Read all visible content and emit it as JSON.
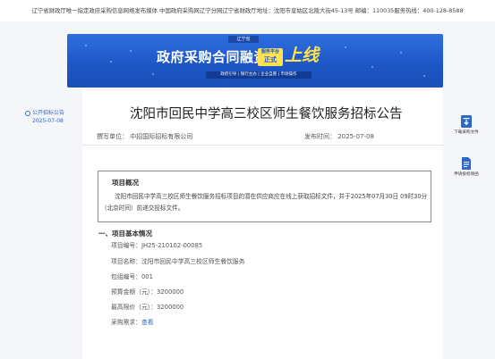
{
  "topbar": {
    "text": "辽宁省财政厅唯一指定政府采购信息网络发布媒体 中国政府采购网辽宁分网辽宁省财政厅地址：沈阳市皇姑区北陵大街45-13号 邮编：110035服务热线：400-128-8588"
  },
  "banner": {
    "tag": "辽宁省",
    "title": "政府采购合同融资",
    "badge_top": "服务平台",
    "badge_bottom": "正式",
    "online": "上线",
    "subtitle": "政府引导 | 银行主办 | 企业自愿 | 市场操作",
    "colors": {
      "background": "#1d55c4",
      "accent": "#ffe14d"
    }
  },
  "sidebar": {
    "label": "公开招标公告",
    "date": "2025-07-08"
  },
  "document": {
    "title": "沈阳市回民中学高三校区师生餐饮服务招标公告",
    "author": "撰写单位： 中招国际招标有限公司",
    "publish_time": "发布时间： 2025-07-08",
    "overview": {
      "heading": "项目概况",
      "text": "沈阳市回民中学高三校区师生餐饮服务招标项目的潜在供应商应在线上获取招标文件，并于2025年07月30日 09时30分（北京时间）前递交投标文件。"
    },
    "basic_info": {
      "heading": "一、项目基本情况",
      "rows": [
        {
          "label": "项目编号：JH25-210102-00085"
        },
        {
          "label": "项目名称：沈阳市回民中学高三校区师生餐饮服务"
        },
        {
          "label": "包组编号：001"
        },
        {
          "label": "预算金额（元）：3200000"
        },
        {
          "label": "最高限价（元）：3200000"
        },
        {
          "label": "采购需求：",
          "link": "查看"
        }
      ]
    }
  },
  "tools": [
    {
      "label": "下载采购文件",
      "icon": "download-document-icon"
    },
    {
      "label": "申请投标保函",
      "icon": "apply-guarantee-icon"
    }
  ],
  "accent_color": "#2c68c9"
}
